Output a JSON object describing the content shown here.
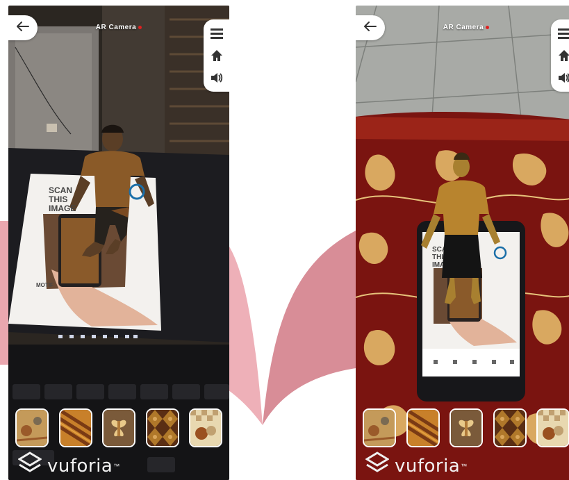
{
  "ar_label": "AR Camera",
  "logo_text": "vuforia",
  "logo_tm": "™",
  "marker_text": [
    "SCAN",
    "THIS",
    "IMAGE",
    "MOTIF"
  ],
  "marker_text_right": [
    "SCAN",
    "THI",
    "IMA"
  ],
  "icons": {
    "back": "back-arrow-icon",
    "menu": "menu-icon",
    "home": "home-icon",
    "sound": "sound-icon",
    "logo": "vuforia-logo-icon"
  },
  "thumb_colors": [
    [
      "#c49a5a",
      "#9a5a2a",
      "#7a6a52"
    ],
    [
      "#c8802a",
      "#7a3a14",
      "#e3a040"
    ],
    [
      "#7a5a3a",
      "#b07a3a",
      "#e8c98a"
    ],
    [
      "#5a2e14",
      "#b0782a",
      "#d9a55a"
    ],
    [
      "#c0a070",
      "#9a5020",
      "#e8d8b0"
    ]
  ],
  "colors": {
    "rec": "#e02020",
    "book": "#e7a3ab",
    "book_dark": "#c97b84"
  }
}
